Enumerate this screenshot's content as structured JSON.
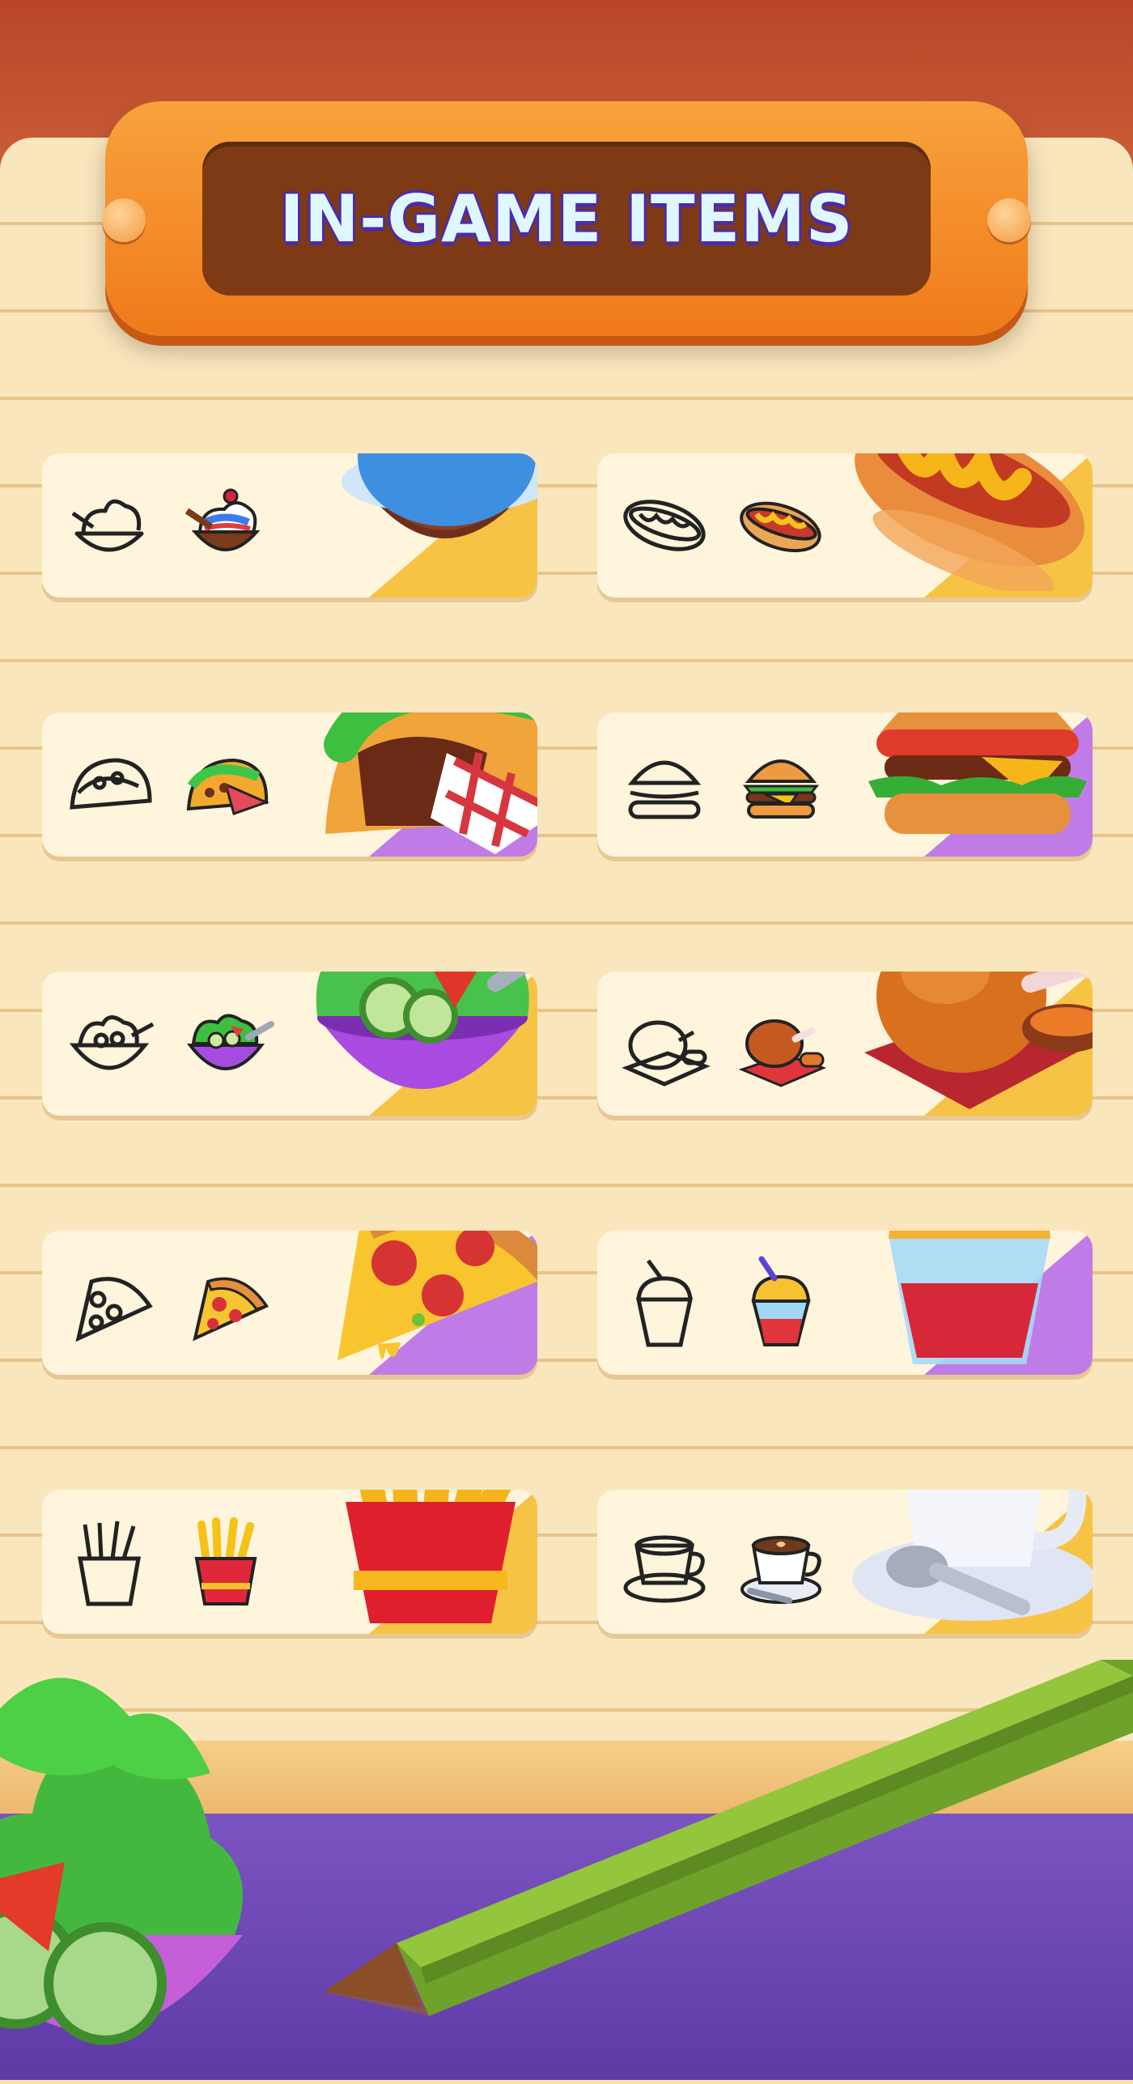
{
  "title": "IN-GAME ITEMS",
  "colors": {
    "plaque": "#f08a22",
    "plaque_inner": "#7d3a14",
    "title_text": "#dff7ff",
    "gold_accent": "#f6c344",
    "purple_accent": "#c07ce6",
    "table": "#6b46b6"
  },
  "items": [
    {
      "name": "ice-cream-sundae",
      "accent": "gold"
    },
    {
      "name": "hot-dog",
      "accent": "gold"
    },
    {
      "name": "taco",
      "accent": "purple"
    },
    {
      "name": "burger",
      "accent": "purple"
    },
    {
      "name": "salad-bowl",
      "accent": "gold"
    },
    {
      "name": "roast-chicken",
      "accent": "gold"
    },
    {
      "name": "pizza-slice",
      "accent": "purple"
    },
    {
      "name": "milkshake",
      "accent": "purple"
    },
    {
      "name": "french-fries",
      "accent": "gold"
    },
    {
      "name": "coffee-cup",
      "accent": "gold"
    }
  ],
  "decorations": [
    "salad-bowl-icon",
    "green-pencil-icon"
  ]
}
